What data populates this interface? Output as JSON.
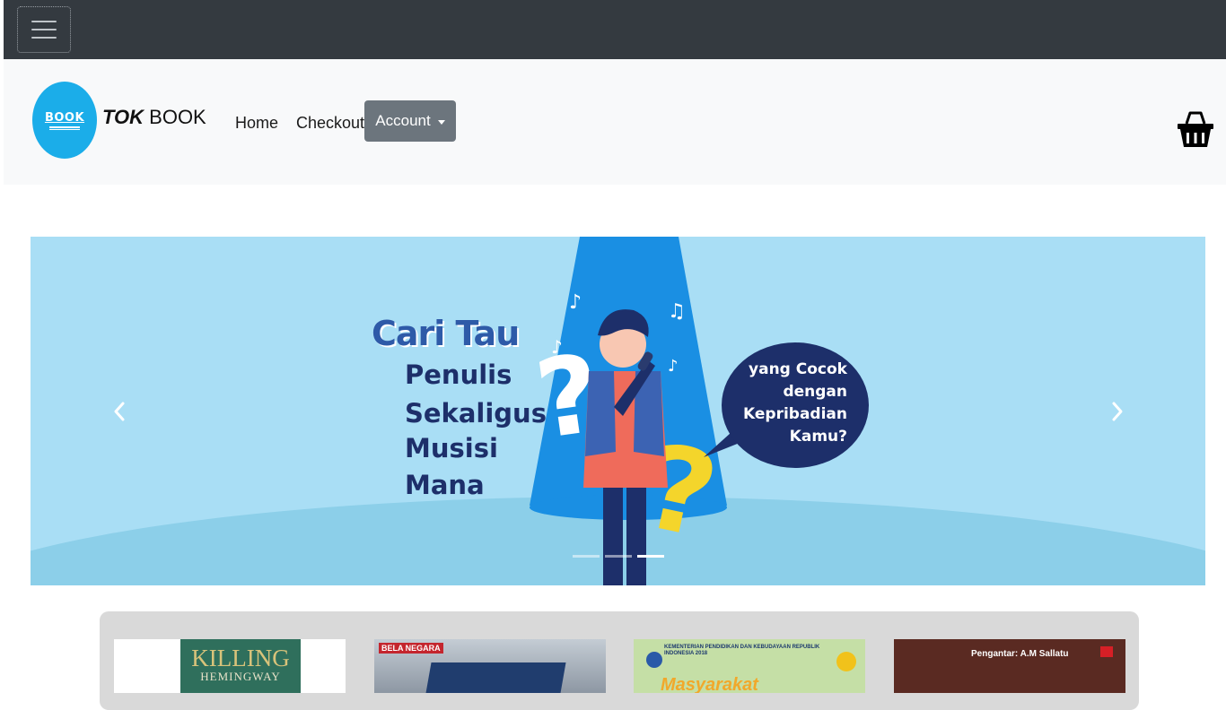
{
  "topbar": {
    "menu_icon": "hamburger-menu-icon"
  },
  "navbar": {
    "logo_text": "BOOK",
    "brand_bold": "TOK",
    "brand_rest": " BOOK",
    "links": [
      {
        "label": "Home"
      },
      {
        "label": "Checkout"
      }
    ],
    "account_label": "Account",
    "cart_icon": "shopping-basket-icon"
  },
  "carousel": {
    "slide": {
      "title": "Cari Tau",
      "lines": [
        "Penulis",
        "Sekaligus",
        "Musisi",
        "Mana"
      ],
      "bubble_lines": [
        "yang Cocok",
        "dengan",
        "Kepribadian",
        "Kamu?"
      ]
    },
    "prev_icon": "chevron-left-icon",
    "next_icon": "chevron-right-icon",
    "slide_count": 3,
    "active_slide": 3
  },
  "books": [
    {
      "title_1": "KILLING",
      "title_2": "HEMINGWAY"
    },
    {
      "tag": "BELA NEGARA"
    },
    {
      "header": "KEMENTERIAN PENDIDIKAN DAN KEBUDAYAAN REPUBLIK INDONESIA 2018",
      "title": "Masyarakat"
    },
    {
      "header": "Pengantar: A.M Sallatu"
    }
  ],
  "colors": {
    "topbar": "#343a40",
    "navbar": "#f8f9fa",
    "logo": "#1bade9",
    "account_button": "#6c757d",
    "banner_bg": "#a9def5",
    "banner_dark": "#1d2f6a"
  }
}
